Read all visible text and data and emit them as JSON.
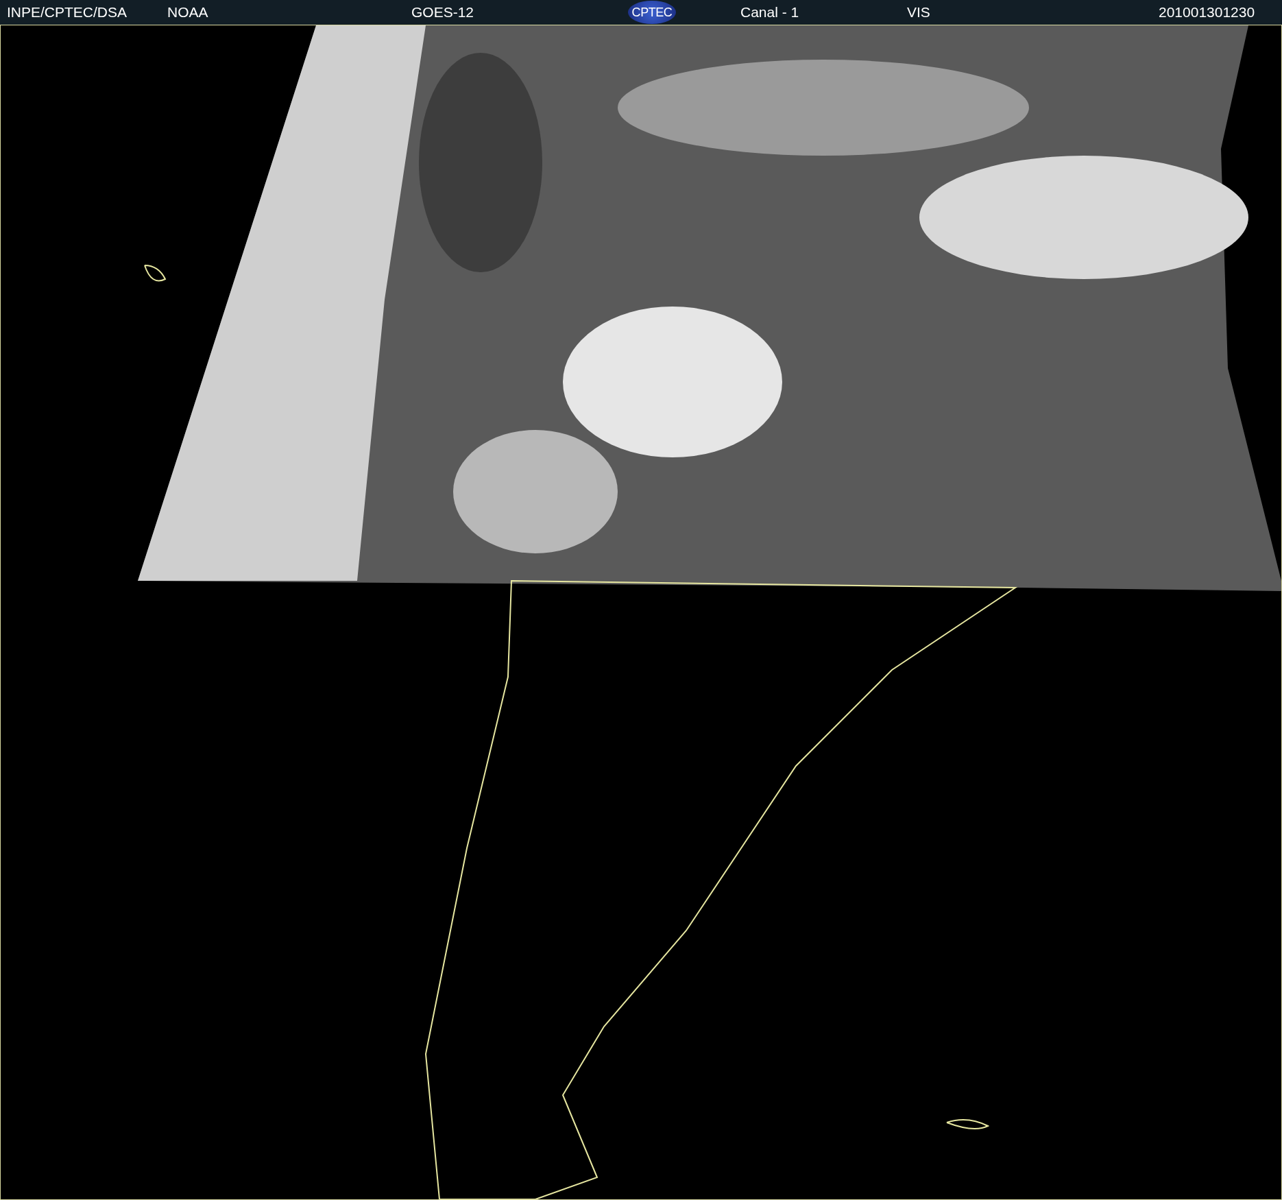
{
  "header": {
    "source": "INPE/CPTEC/DSA",
    "agency": "NOAA",
    "satellite": "GOES-12",
    "logo": "CPTEC",
    "channel": "Canal - 1",
    "band": "VIS",
    "timestamp": "201001301230"
  }
}
